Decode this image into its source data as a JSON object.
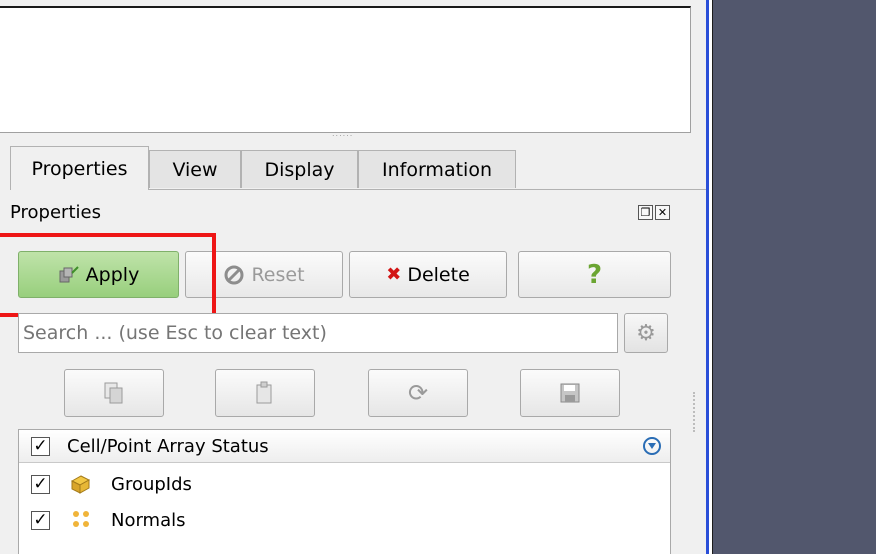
{
  "tabs": [
    {
      "label": "Properties",
      "active": true
    },
    {
      "label": "View",
      "active": false
    },
    {
      "label": "Display",
      "active": false
    },
    {
      "label": "Information",
      "active": false
    }
  ],
  "panel": {
    "title": "Properties",
    "float_icon": "restore-icon",
    "close_icon": "close-icon"
  },
  "buttons": {
    "apply": "Apply",
    "reset": "Reset",
    "delete": "Delete",
    "help": "?"
  },
  "search": {
    "placeholder": "Search ... (use Esc to clear text)"
  },
  "toolbar_icons": [
    "copy-icon",
    "paste-icon",
    "refresh-icon",
    "save-icon"
  ],
  "array_panel": {
    "header": "Cell/Point Array Status",
    "items": [
      {
        "label": "GroupIds",
        "checked": true,
        "icon": "cell-data-icon"
      },
      {
        "label": "Normals",
        "checked": true,
        "icon": "point-data-icon"
      }
    ]
  },
  "colors": {
    "highlight": "#ee1515",
    "render_view_bg": "#52576d",
    "apply_green": "#98cf7d"
  }
}
